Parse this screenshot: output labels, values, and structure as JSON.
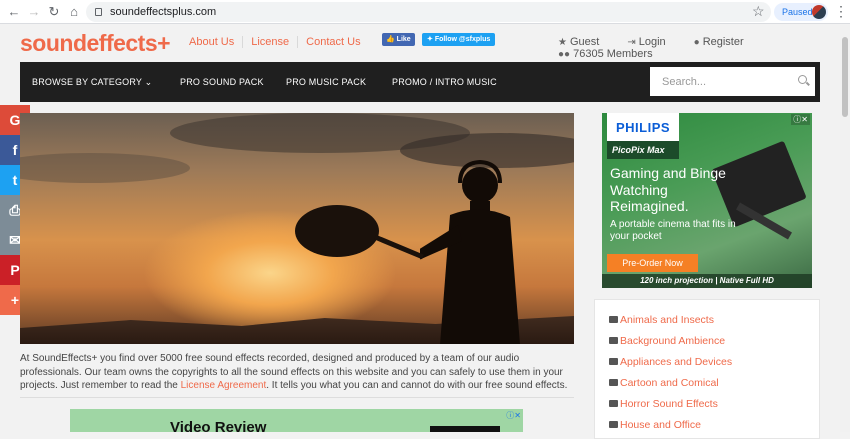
{
  "browser": {
    "url": "soundeffectsplus.com",
    "profile_status": "Paused"
  },
  "site": {
    "logo": "soundeffects+",
    "top_links": [
      "About Us",
      "License",
      "Contact Us"
    ],
    "fb_like": "Like",
    "tw_follow": "Follow @sfxplus",
    "user_links": {
      "guest": "Guest",
      "login": "Login",
      "register": "Register",
      "members": "76305 Members"
    }
  },
  "nav": {
    "items": [
      "BROWSE BY CATEGORY",
      "PRO SOUND PACK",
      "PRO MUSIC PACK",
      "PROMO / INTRO MUSIC"
    ],
    "search_placeholder": "Search..."
  },
  "share": [
    {
      "name": "google",
      "glyph": "G",
      "color": "#dd4b39"
    },
    {
      "name": "facebook",
      "glyph": "f",
      "color": "#3b5998"
    },
    {
      "name": "twitter",
      "glyph": "t",
      "color": "#1da1f2"
    },
    {
      "name": "print",
      "glyph": "⎙",
      "color": "#7d8c97"
    },
    {
      "name": "email",
      "glyph": "✉",
      "color": "#7d8c97"
    },
    {
      "name": "pinterest",
      "glyph": "P",
      "color": "#cb2027"
    },
    {
      "name": "more",
      "glyph": "+",
      "color": "#ef6a4a"
    }
  ],
  "intro": {
    "text_before": "At SoundEffects+ you find over 5000 free sound effects recorded, designed and produced by a team of our audio professionals. Our team owns the copyrights to all the sound effects on this website and you can safely to use them in your projects. Just remember to read the ",
    "link": "License Agreement",
    "text_after": ". It tells you what you can and cannot do with our free sound effects."
  },
  "ad_right": {
    "brand": "PHILIPS",
    "model": "PicoPix Max",
    "headline": "Gaming and Binge Watching Reimagined.",
    "subline": "A portable cinema that fits in your pocket",
    "cta": "Pre-Order Now",
    "footer": "120 inch projection | Native Full HD"
  },
  "ad_bottom": {
    "title": "Video Review"
  },
  "categories": [
    "Animals and Insects",
    "Background Ambience",
    "Appliances and Devices",
    "Cartoon and Comical",
    "Horror Sound Effects",
    "House and Office"
  ]
}
